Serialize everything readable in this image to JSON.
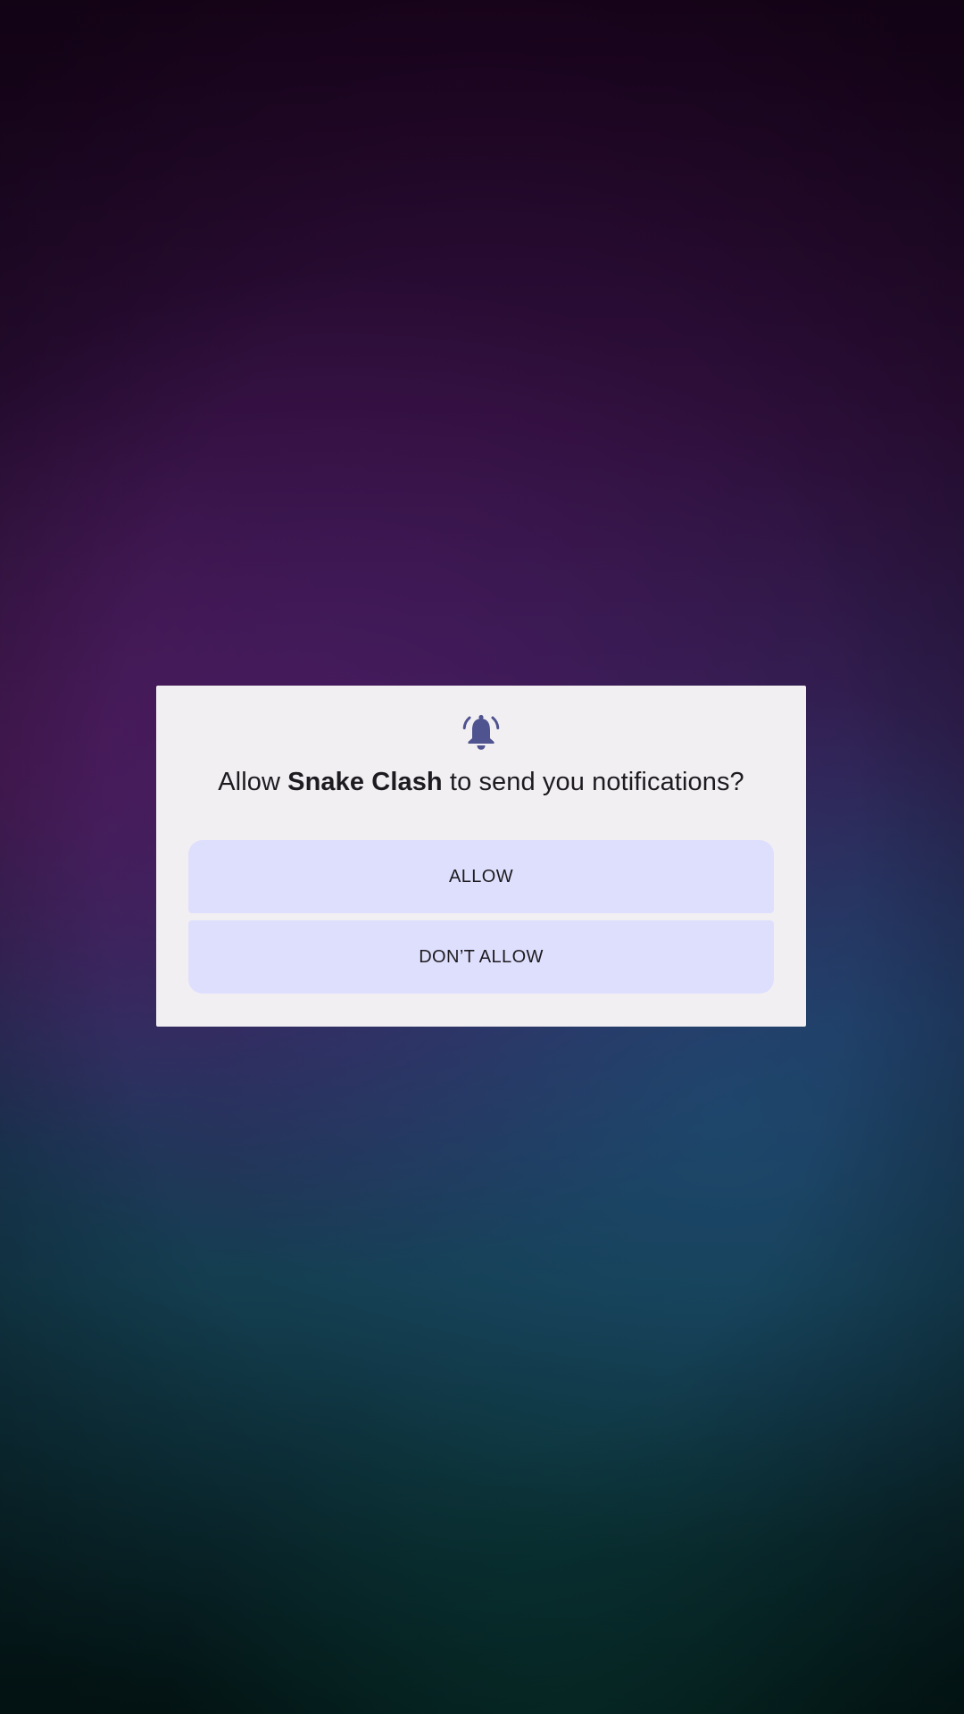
{
  "dialog": {
    "icon": "notification-bell-icon",
    "title_prefix": "Allow ",
    "app_name": "Snake Clash",
    "title_suffix": " to send you notifications?",
    "allow_label": "ALLOW",
    "deny_label": "DON’T ALLOW"
  },
  "colors": {
    "dialog_background": "#f2eff3",
    "button_background": "#dedffd",
    "icon_color": "#4f538f",
    "text_color": "#1d1b20"
  }
}
